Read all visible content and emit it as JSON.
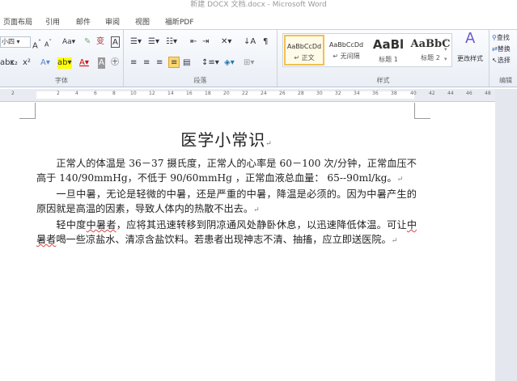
{
  "window": {
    "title": "新建 DOCX 文档.docx - Microsoft Word"
  },
  "tabs": [
    "页面布局",
    "引用",
    "邮件",
    "审阅",
    "视图",
    "福昕PDF"
  ],
  "font_group": {
    "label": "字体",
    "size": "小四"
  },
  "paragraph_group": {
    "label": "段落"
  },
  "styles_group": {
    "label": "样式",
    "styles": [
      {
        "sample": "AaBbCcDd",
        "name": "↵ 正文"
      },
      {
        "sample": "AaBbCcDd",
        "name": "↵ 无间隔"
      },
      {
        "sample": "AaBl",
        "name": "标题 1"
      },
      {
        "sample": "AaBbC",
        "name": "标题 2"
      }
    ],
    "change_styles": "更改样式"
  },
  "editing_group": {
    "label": "编辑",
    "find": "查找",
    "replace": "替换",
    "select": "选择"
  },
  "ruler": [
    "2",
    "2",
    "4",
    "6",
    "8",
    "10",
    "12",
    "14",
    "16",
    "18",
    "20",
    "22",
    "24",
    "26",
    "28",
    "30",
    "32",
    "34",
    "36",
    "38",
    "40",
    "42",
    "44",
    "46",
    "48"
  ],
  "document": {
    "title": "医学小常识",
    "p1": "正常人的体温是 36－37 摄氏度，正常人的心率是 60－100 次/分钟，正常血压不高于 140/90mmHg，不低于 90/60mmHg ，正常血液总血量： 65--90ml/kg。",
    "p2": "一旦中暑，无论是轻微的中暑，还是严重的中暑，降温是必须的。因为中暑产生的原因就是高温的因素，导致人体内的热散不出去。",
    "p3a": "轻中度",
    "p3b": "中暑者",
    "p3c": "，应将其迅速转移到阴凉通风处静卧休息，以迅速降低体温。可让",
    "p3d": "中暑者",
    "p3e": "喝一些凉盐水、清凉含盐饮料。若患者出现神志不清、抽搐，应立即送医院。",
    "para_mark": "↵"
  }
}
